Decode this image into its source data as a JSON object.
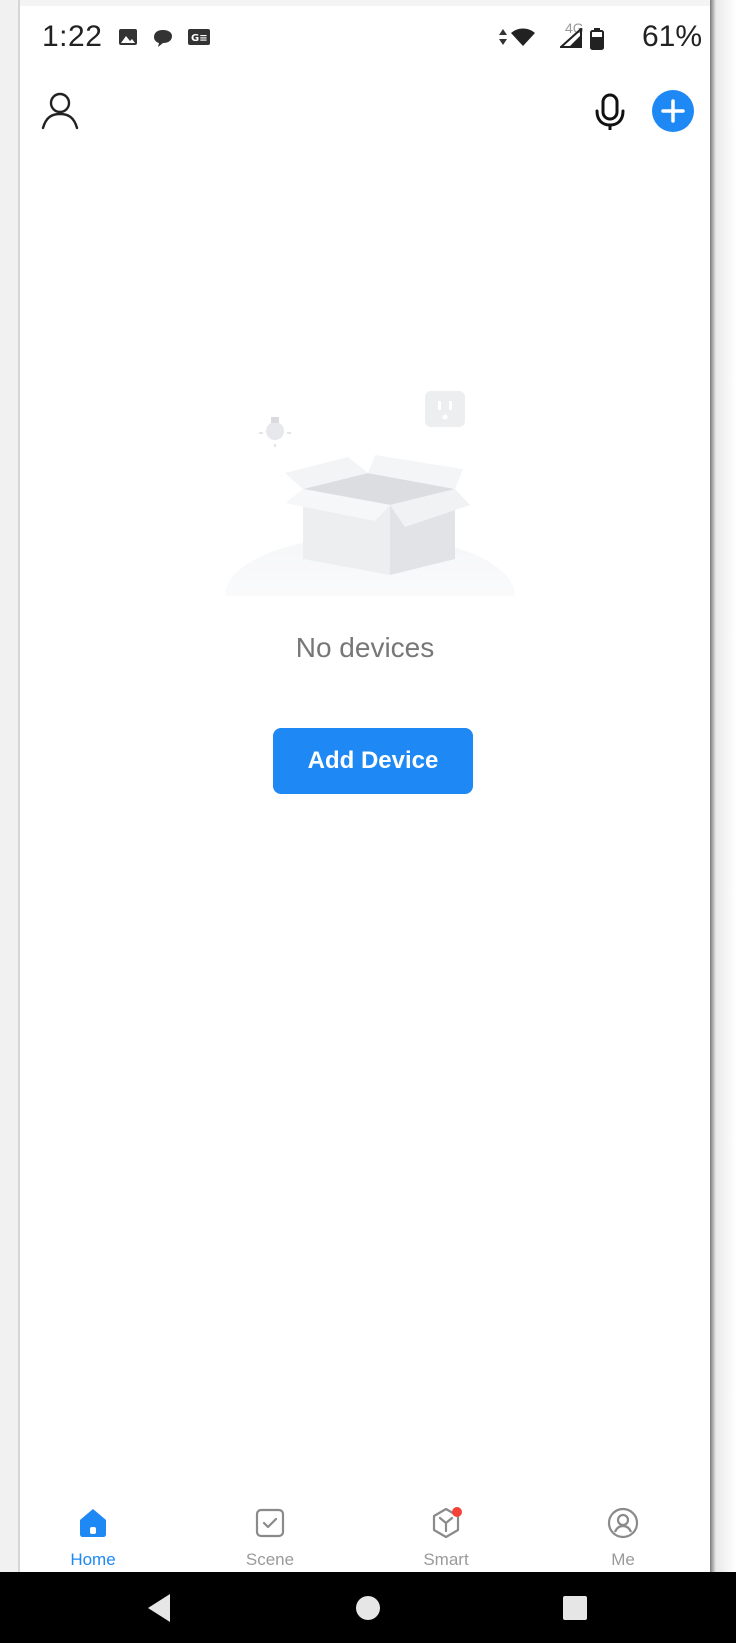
{
  "status_bar": {
    "time": "1:22",
    "network": "4G",
    "battery_percent": "61%"
  },
  "top_bar": {
    "icons": [
      "user-icon",
      "microphone-icon",
      "plus-icon"
    ]
  },
  "empty_state": {
    "message": "No devices",
    "button_label": "Add Device"
  },
  "tabs": [
    {
      "label": "Home",
      "icon": "home-icon",
      "active": true
    },
    {
      "label": "Scene",
      "icon": "scene-check-icon",
      "active": false
    },
    {
      "label": "Smart",
      "icon": "smart-cube-icon",
      "active": false,
      "badge": true
    },
    {
      "label": "Me",
      "icon": "me-profile-icon",
      "active": false
    }
  ],
  "colors": {
    "accent": "#1e88f4",
    "badge": "#f44336",
    "muted_text": "#777777",
    "tab_inactive": "#9a9a9a"
  }
}
